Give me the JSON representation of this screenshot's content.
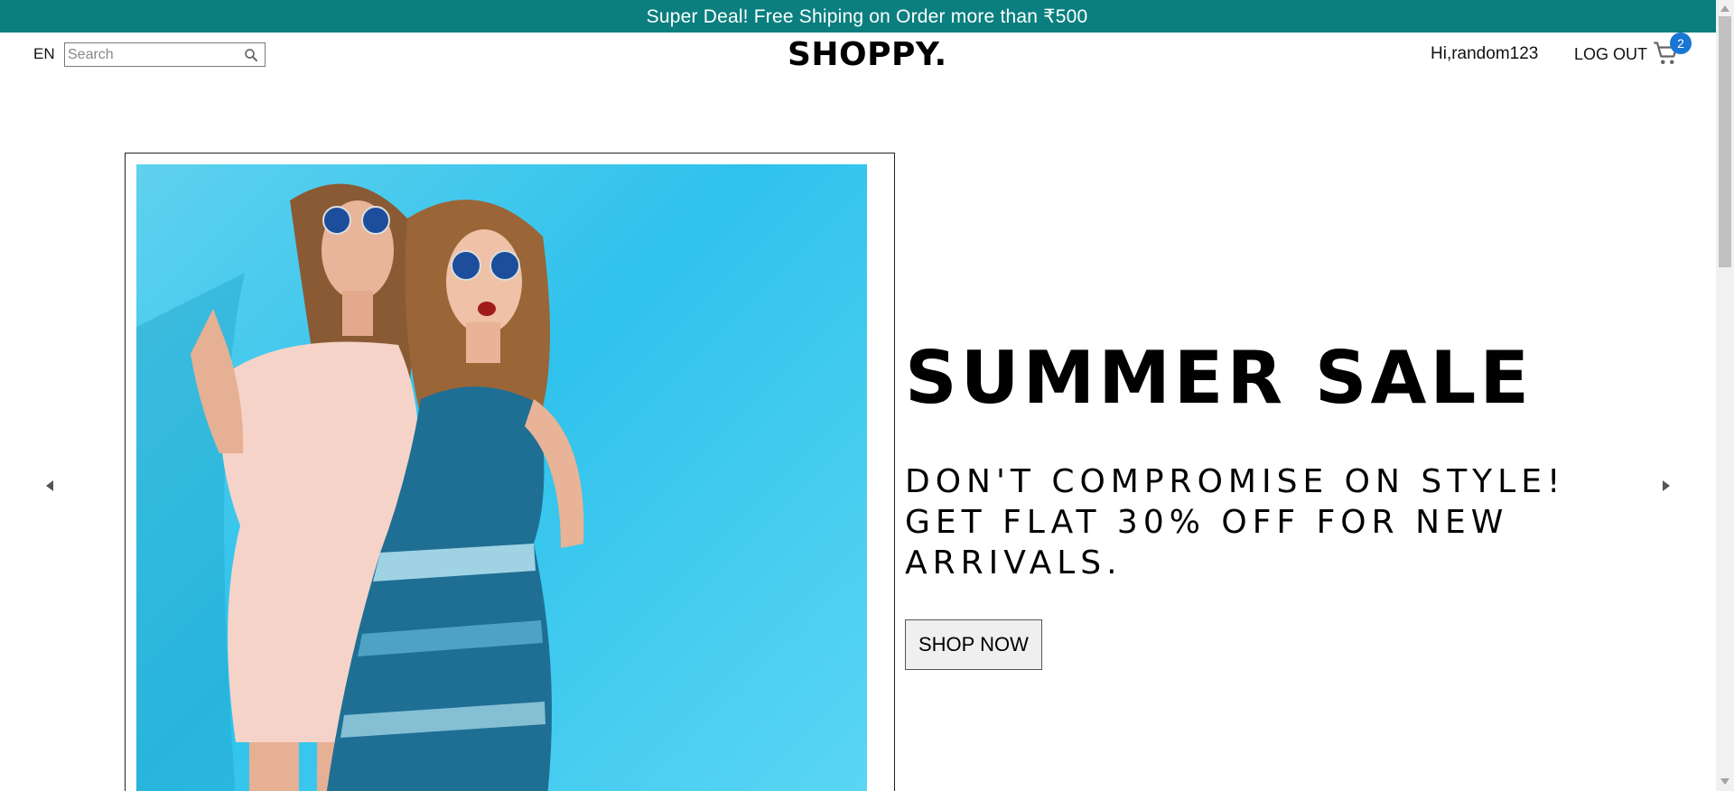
{
  "announcement": {
    "text": "Super Deal! Free Shiping on Order more than ₹500"
  },
  "navbar": {
    "language": "EN",
    "search_placeholder": "Search",
    "logo": "SHOPPY.",
    "greeting": "Hi,random123",
    "logout_label": "LOG OUT",
    "cart_count": "2",
    "cart_badge_color": "#1976d2"
  },
  "slider": {
    "title": "SUMMER SALE",
    "description": "DON'T COMPROMISE ON STYLE! GET FLAT 30% OFF FOR NEW ARRIVALS.",
    "button_label": "SHOP NOW",
    "prev_icon": "arrow-left-icon",
    "next_icon": "arrow-right-icon"
  },
  "colors": {
    "announcement_bg": "#0b7f7f",
    "hero_bg": "#2fc2ec"
  }
}
